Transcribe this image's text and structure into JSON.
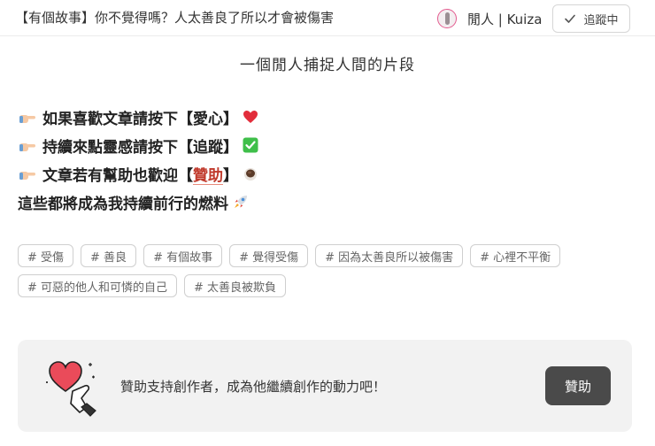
{
  "header": {
    "article_title": "【有個故事】你不覺得嗎？人太善良了所以才會被傷害",
    "author_name": "閒人 | Kuiza",
    "follow_label": "追蹤中"
  },
  "subtitle": "一個閒人捕捉人間的片段",
  "lines": [
    {
      "pre": "如果喜歡文章請按下【愛心】",
      "icon": "heart-icon"
    },
    {
      "pre": "持續來點靈感請按下【追蹤】",
      "icon": "checkmark-box-icon"
    },
    {
      "pre": "文章若有幫助也歡迎【",
      "link": "贊助",
      "post": "】",
      "icon": "coffee-cup-icon"
    },
    {
      "pre": "這些都將成為我持續前行的燃料",
      "icon": "rocket-icon"
    }
  ],
  "tags": [
    "# 受傷",
    "# 善良",
    "# 有個故事",
    "# 覺得受傷",
    "# 因為太善良所以被傷害",
    "# 心裡不平衡",
    "# 可惡的他人和可憐的自己",
    "# 太善良被欺負"
  ],
  "sponsor": {
    "text": "贊助支持創作者，成為他繼續創作的動力吧！",
    "button_label": "贊助"
  },
  "colors": {
    "accent_link": "#c0392b",
    "sponsor_button": "#4a4a4a",
    "card_bg": "#f2f2f2"
  }
}
